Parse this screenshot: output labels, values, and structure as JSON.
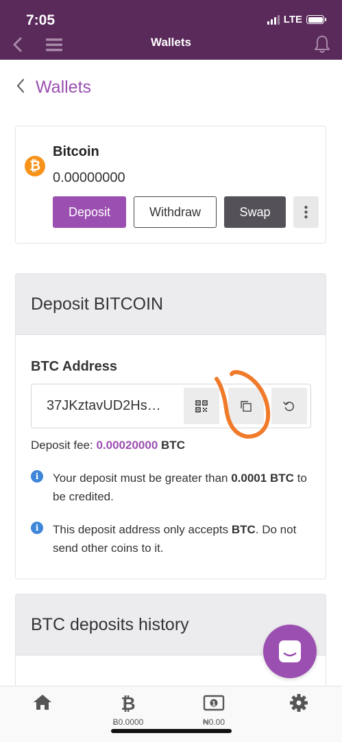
{
  "status_bar": {
    "time": "7:05",
    "network": "LTE"
  },
  "navbar": {
    "title": "Wallets"
  },
  "page": {
    "back_title": "Wallets"
  },
  "wallet": {
    "coin_symbol": "₿",
    "coin_name": "Bitcoin",
    "balance": "0.00000000",
    "buttons": {
      "deposit": "Deposit",
      "withdraw": "Withdraw",
      "swap": "Swap"
    }
  },
  "deposit": {
    "title": "Deposit BITCOIN",
    "address_label": "BTC Address",
    "address_value": "37JKztavUD2Hs…",
    "fee_label": "Deposit fee:",
    "fee_value": "0.00020000",
    "fee_unit": "BTC",
    "info1": {
      "a": "Your deposit must be greater than ",
      "b": "0.0001 BTC",
      "c": " to be credited."
    },
    "info2": {
      "a": "This deposit address only accepts ",
      "b": "BTC",
      "c": ". Do not send other coins to it."
    }
  },
  "history": {
    "title": "BTC deposits history"
  },
  "tabbar": {
    "btc_balance": "Ƀ0.0000",
    "ngn_balance": "₦0.00"
  },
  "colors": {
    "brand": "#5a2a5a",
    "accent": "#9b4fb0",
    "annotation": "#f07a2a",
    "bitcoin": "#f7931a"
  }
}
